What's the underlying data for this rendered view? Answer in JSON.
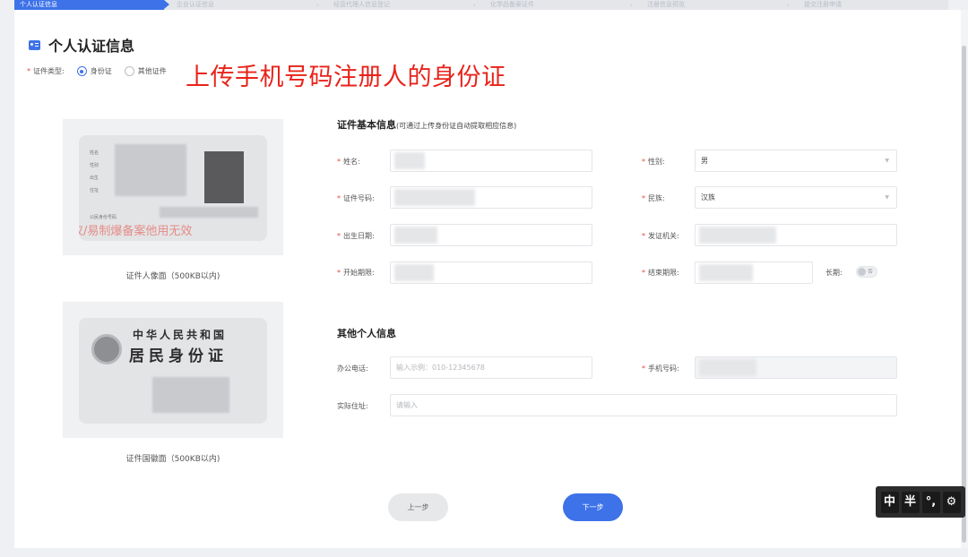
{
  "steps": [
    "个人认证信息",
    "企业认证信息",
    "经营代理人信息登记",
    "化学品备案证件",
    "注册信息预览",
    "提交注册申请"
  ],
  "page": {
    "title": "个人认证信息",
    "banner": "上传手机号码注册人的身份证"
  },
  "cert_type": {
    "label": "证件类型:",
    "options": [
      "身份证",
      "其他证件"
    ],
    "selected": "身份证"
  },
  "id_images": {
    "front_caption": "证件人像面（500KB以内)",
    "back_caption": "证件国徽面（500KB以内)",
    "back_title_1": "中华人民共和国",
    "back_title_2": "居民身份证",
    "stamp_text": "仅/易制爆备案他用无效"
  },
  "basic_info": {
    "title": "证件基本信息",
    "hint": "(可通过上传身份证自动提取相应信息)",
    "name_label": "姓名:",
    "gender_label": "性别:",
    "gender_value": "男",
    "id_number_label": "证件号码:",
    "ethnicity_label": "民族:",
    "ethnicity_value": "汉族",
    "birth_label": "出生日期:",
    "authority_label": "发证机关:",
    "start_label": "开始期限:",
    "end_label": "结束期限:",
    "long_term_label": "长期:",
    "long_term_value": "否"
  },
  "other_info": {
    "title": "其他个人信息",
    "office_phone_label": "办公电话:",
    "office_phone_placeholder": "输入示例：010-12345678",
    "mobile_label": "手机号码:",
    "address_label": "实际住址:",
    "address_placeholder": "请输入"
  },
  "buttons": {
    "prev": "上一步",
    "next": "下一步"
  },
  "ime": {
    "k1": "中",
    "k2": "半",
    "k3": "°,",
    "k4": "⚙"
  }
}
